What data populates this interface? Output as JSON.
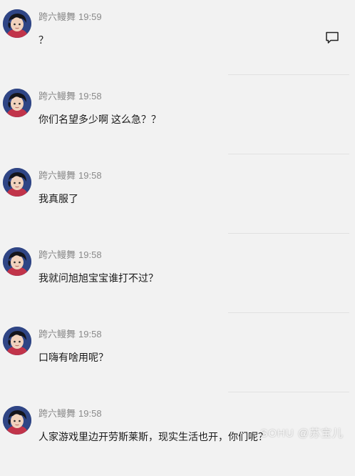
{
  "feed": {
    "messages": [
      {
        "author": "跨六鳗舞",
        "time": "19:59",
        "text": "？"
      },
      {
        "author": "跨六鳗舞",
        "time": "19:58",
        "text": "你们名望多少啊 这么急？？"
      },
      {
        "author": "跨六鳗舞",
        "time": "19:58",
        "text": "我真服了"
      },
      {
        "author": "跨六鳗舞",
        "time": "19:58",
        "text": "我就问旭旭宝宝谁打不过？"
      },
      {
        "author": "跨六鳗舞",
        "time": "19:58",
        "text": "口嗨有啥用呢？"
      },
      {
        "author": "跨六鳗舞",
        "time": "19:58",
        "text": "人家游戏里边开劳斯莱斯，现实生活也开，你们呢？"
      }
    ],
    "reply_icon": "comment-icon"
  },
  "watermark": {
    "text": "SOHU @苏宝儿"
  },
  "colors": {
    "background": "#f2f2f2",
    "meta_text": "#8a8a8a",
    "body_text": "#1a1a1a",
    "divider": "#e1e1e1"
  }
}
